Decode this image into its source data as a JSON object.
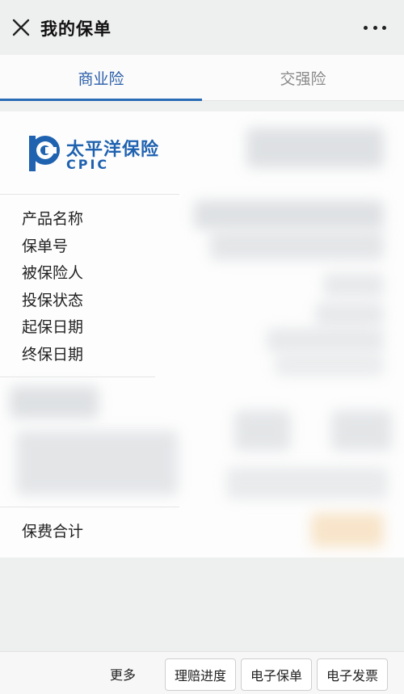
{
  "header": {
    "title": "我的保单",
    "close_icon": "close-icon",
    "more_icon": "more-horizontal-icon"
  },
  "tabs": [
    {
      "label": "商业险",
      "active": true
    },
    {
      "label": "交强险",
      "active": false
    }
  ],
  "policy": {
    "insurer_name_cn": "太平洋保险",
    "insurer_name_en": "CPIC",
    "fields": [
      {
        "label": "产品名称"
      },
      {
        "label": "保单号"
      },
      {
        "label": "被保险人"
      },
      {
        "label": "投保状态"
      },
      {
        "label": "起保日期"
      },
      {
        "label": "终保日期"
      }
    ],
    "premium_label": "保费合计"
  },
  "bottom_bar": {
    "more_label": "更多",
    "claim_progress_label": "理赔进度",
    "e_policy_label": "电子保单",
    "e_invoice_label": "电子发票"
  },
  "colors": {
    "accent": "#2a6bb5",
    "brand": "#1f62b0",
    "background": "#eef0ef"
  }
}
